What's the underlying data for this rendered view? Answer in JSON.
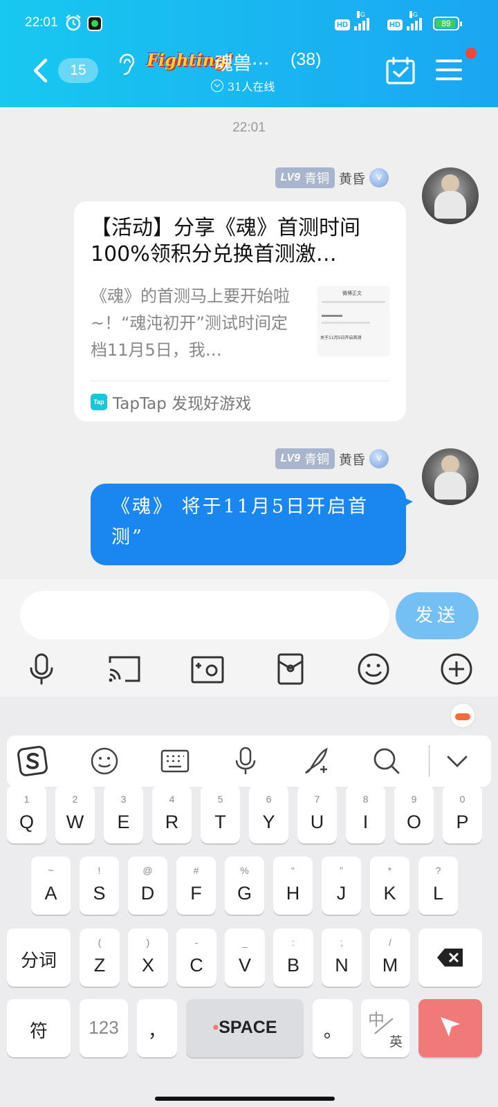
{
  "status_bar": {
    "time": "22:01",
    "hd1": "HD",
    "hd2": "HD",
    "net1": "4G",
    "net2": "4G",
    "battery": "89"
  },
  "header": {
    "unread_count": "15",
    "group_logo": "Fighting!",
    "group_name": "魂兽···",
    "member_count": "(38)",
    "online_text": "31人在线"
  },
  "chat": {
    "time_separator": "22:01",
    "messages": [
      {
        "level": "LV9",
        "rank": "青铜",
        "nickname": "黄昏",
        "badge": "V",
        "card": {
          "title": "【活动】分享《魂》首测时间 100%领积分兑换首测激…",
          "desc": "《魂》的首测马上要开始啦~！“魂沌初开”测试时间定档11月5日，我…",
          "thumb_title": "微博正文",
          "thumb_caption": "关于11月5日开启首测",
          "source_icon": "Tap",
          "source": "TapTap 发现好游戏"
        }
      },
      {
        "level": "LV9",
        "rank": "青铜",
        "nickname": "黄昏",
        "badge": "V",
        "text": "《魂》 将于11月5日开启首测”"
      }
    ]
  },
  "input": {
    "placeholder": "",
    "send_label": "发送"
  },
  "toolbar_icons": [
    "mic-icon",
    "screen-cast-icon",
    "photo-icon",
    "red-packet-icon",
    "emoji-icon",
    "plus-icon"
  ],
  "keyboard": {
    "row1": [
      {
        "sub": "1",
        "main": "Q"
      },
      {
        "sub": "2",
        "main": "W"
      },
      {
        "sub": "3",
        "main": "E"
      },
      {
        "sub": "4",
        "main": "R"
      },
      {
        "sub": "5",
        "main": "T"
      },
      {
        "sub": "6",
        "main": "Y"
      },
      {
        "sub": "7",
        "main": "U"
      },
      {
        "sub": "8",
        "main": "I"
      },
      {
        "sub": "9",
        "main": "O"
      },
      {
        "sub": "0",
        "main": "P"
      }
    ],
    "row2": [
      {
        "sub": "~",
        "main": "A"
      },
      {
        "sub": "!",
        "main": "S"
      },
      {
        "sub": "@",
        "main": "D"
      },
      {
        "sub": "#",
        "main": "F"
      },
      {
        "sub": "%",
        "main": "G"
      },
      {
        "sub": "“",
        "main": "H"
      },
      {
        "sub": "”",
        "main": "J"
      },
      {
        "sub": "*",
        "main": "K"
      },
      {
        "sub": "?",
        "main": "L"
      }
    ],
    "row3": [
      {
        "sub": "(",
        "main": "Z"
      },
      {
        "sub": ")",
        "main": "X"
      },
      {
        "sub": "-",
        "main": "C"
      },
      {
        "sub": "_",
        "main": "V"
      },
      {
        "sub": ":",
        "main": "B"
      },
      {
        "sub": ";",
        "main": "N"
      },
      {
        "sub": "/",
        "main": "M"
      }
    ],
    "fenci": "分词",
    "symbol": "符",
    "num": "123",
    "comma": "，",
    "space": "SPACE",
    "period": "。",
    "lang_cn": "中",
    "lang_en": "英"
  },
  "colors": {
    "header_start": "#18c8f0",
    "header_end": "#1aa6f2",
    "bubble": "#1a86f0",
    "send": "#74c0f5",
    "enter": "#f07a7a"
  }
}
